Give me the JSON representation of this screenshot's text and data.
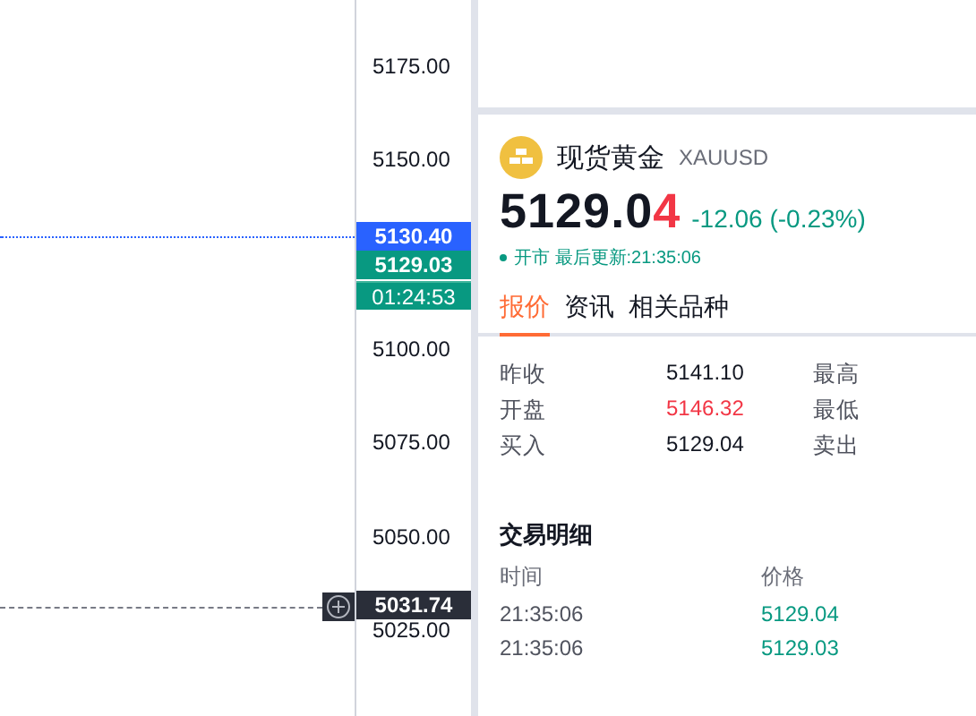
{
  "price_axis": {
    "labels": [
      "5175.00",
      "5150.00",
      "5100.00",
      "5075.00",
      "5050.00",
      "5025.00"
    ],
    "markers": [
      {
        "kind": "last",
        "text": "5130.40"
      },
      {
        "kind": "bid",
        "text": "5129.03"
      },
      {
        "kind": "countdown",
        "text": "01:24:53"
      },
      {
        "kind": "crosshair",
        "text": "5031.74"
      }
    ]
  },
  "quote": {
    "name": "现货黄金",
    "symbol": "XAUUSD",
    "price": "5129.0",
    "price_tick": "4",
    "change": "-12.06 (-0.23%)",
    "status": "开市 最后更新:21:35:06"
  },
  "tabs": [
    {
      "label": "报价",
      "selected": true
    },
    {
      "label": "资讯",
      "selected": false
    },
    {
      "label": "相关品种",
      "selected": false
    }
  ],
  "stats": [
    {
      "label": "昨收",
      "value": "5141.10",
      "color": "#131722",
      "label_2": "最高"
    },
    {
      "label": "开盘",
      "value": "5146.32",
      "color": "#f23645",
      "label_2": "最低"
    },
    {
      "label": "买入",
      "value": "5129.04",
      "color": "#131722",
      "label_2": "卖出"
    }
  ],
  "trades": {
    "title": "交易明细",
    "columns": [
      "时间",
      "价格"
    ],
    "rows": [
      {
        "time": "21:35:06",
        "price": "5129.04",
        "color": "#089981"
      },
      {
        "time": "21:35:06",
        "price": "5129.03",
        "color": "#089981"
      }
    ]
  }
}
